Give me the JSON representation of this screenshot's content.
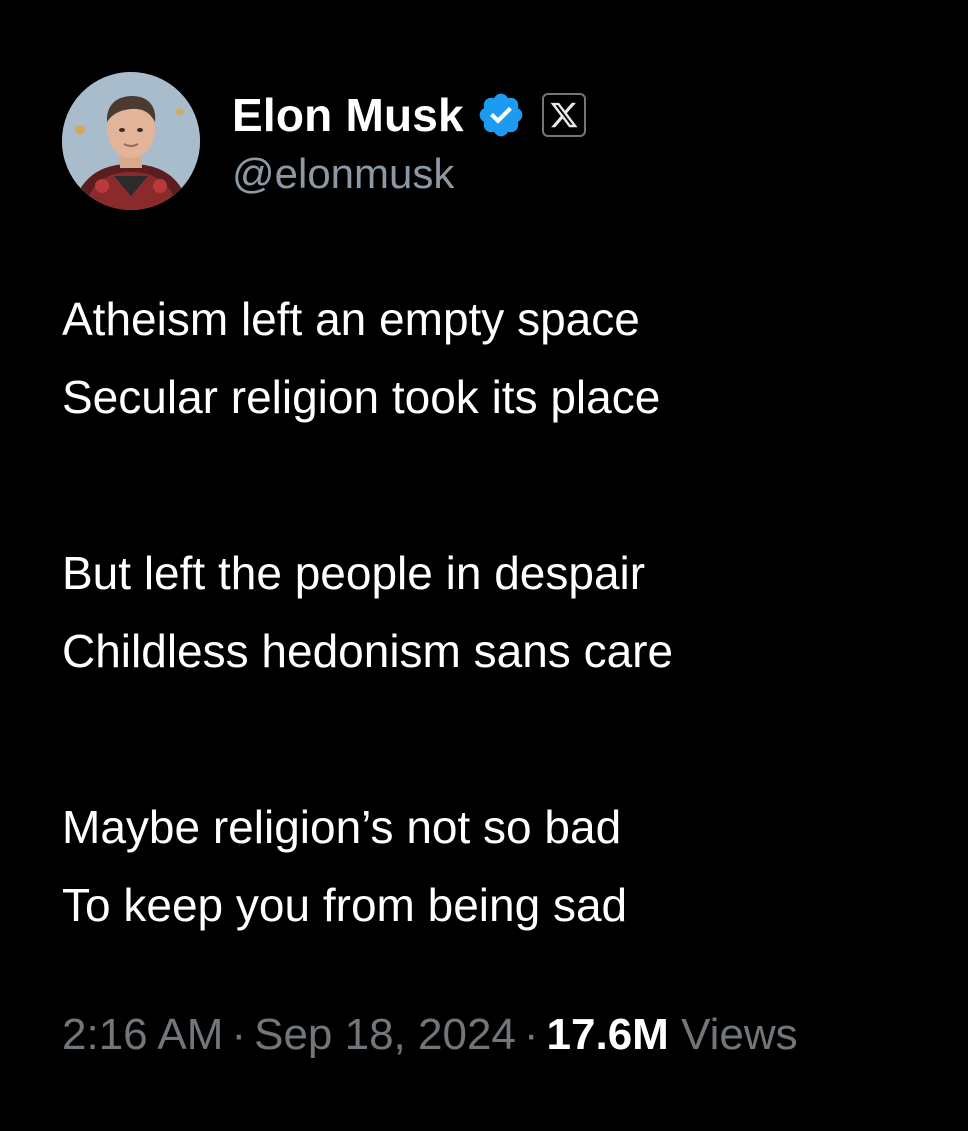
{
  "author": {
    "display_name": "Elon Musk",
    "handle": "@elonmusk",
    "verified_icon": "verified-badge-icon",
    "verified_color": "#1d9bf0",
    "affiliate_icon": "x-logo-icon"
  },
  "tweet": {
    "stanzas": [
      {
        "lines": [
          "Atheism left an empty space",
          "Secular religion took its place"
        ]
      },
      {
        "lines": [
          "But left the people in despair",
          "Childless hedonism sans care"
        ]
      },
      {
        "lines": [
          "Maybe religion’s not so bad",
          "To keep you from being sad"
        ]
      }
    ]
  },
  "meta": {
    "time": "2:16 AM",
    "date": "Sep 18, 2024",
    "views_count": "17.6M",
    "views_label": "Views",
    "separator": "·"
  },
  "colors": {
    "background": "#000000",
    "text_primary": "#ffffff",
    "text_secondary": "#71767b"
  }
}
